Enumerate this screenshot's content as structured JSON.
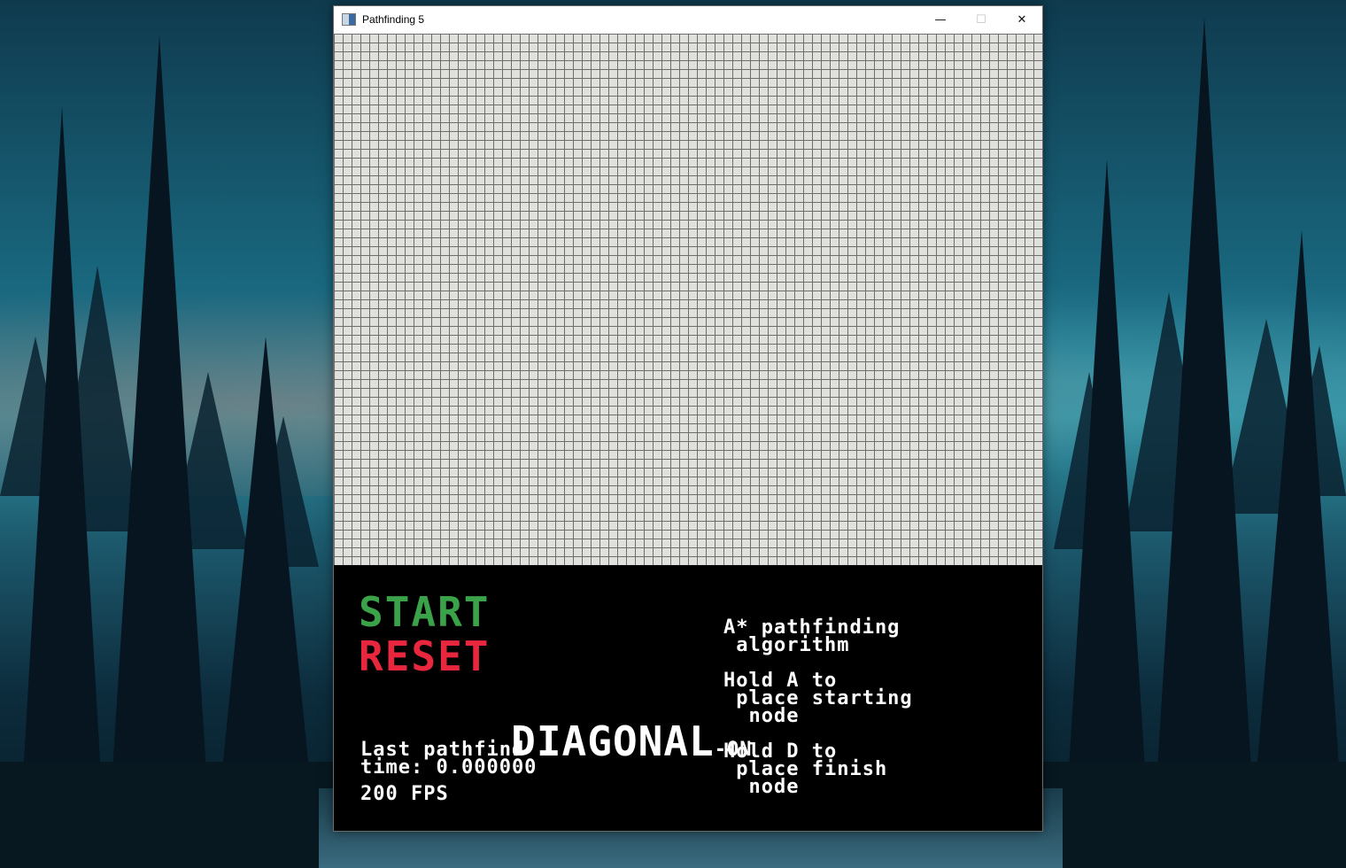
{
  "window": {
    "title": "Pathfinding 5",
    "minimize_glyph": "—",
    "maximize_glyph": "☐",
    "close_glyph": "✕"
  },
  "grid": {
    "columns": 80,
    "rows": 60
  },
  "controls": {
    "start_label": "START",
    "reset_label": "RESET",
    "diagonal_label": "DIAGONAL",
    "diagonal_state": "-ON"
  },
  "stats": {
    "last_pathfind_line1": "Last pathfind",
    "last_pathfind_line2": "time: 0.000000",
    "fps": "200 FPS"
  },
  "help": {
    "algorithm_line1": "A* pathfinding",
    "algorithm_line2": " algorithm",
    "start_line1": "Hold A to",
    "start_line2": " place starting",
    "start_line3": "  node",
    "finish_line1": "Hold D to",
    "finish_line2": " place finish",
    "finish_line3": "  node"
  },
  "colors": {
    "start": "#3aa34a",
    "reset": "#e8273f",
    "panel_bg": "#000000",
    "grid_bg": "#e0e0dc",
    "grid_lines": "#6e6e6e"
  },
  "icons": {
    "app": "app-window-icon",
    "minimize": "minimize-icon",
    "maximize": "maximize-icon",
    "close": "close-icon"
  }
}
